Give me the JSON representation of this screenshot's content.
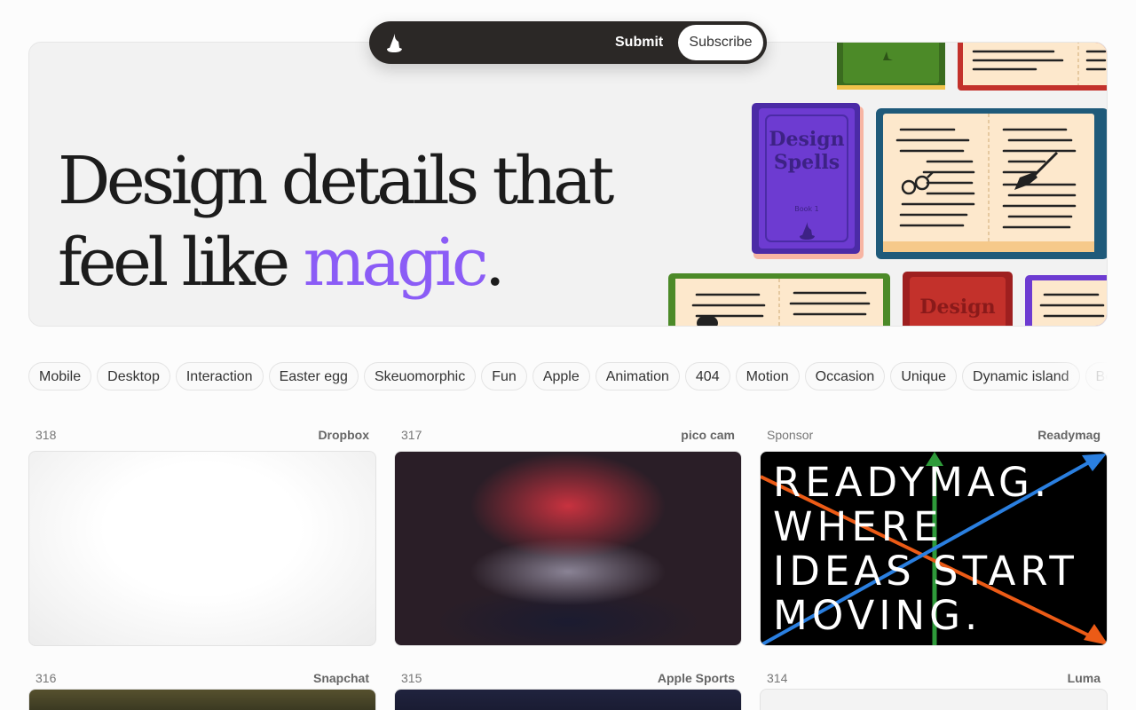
{
  "nav": {
    "logo_icon": "wizard-hat-icon",
    "submit_label": "Submit",
    "subscribe_label": "Subscribe"
  },
  "hero": {
    "line1": "Design details that",
    "line2_prefix": "feel like ",
    "line2_accent": "magic",
    "line2_suffix": ".",
    "accent_color": "#8b5cf6",
    "book_text": {
      "title_line1": "Design",
      "title_line2": "Spells",
      "subtitle": "Book 1"
    }
  },
  "tags": [
    "Mobile",
    "Desktop",
    "Interaction",
    "Easter egg",
    "Skeuomorphic",
    "Fun",
    "Apple",
    "Animation",
    "404",
    "Motion",
    "Occasion",
    "Unique",
    "Dynamic island",
    "Be"
  ],
  "cards": [
    {
      "number": "318",
      "brand": "Dropbox"
    },
    {
      "number": "317",
      "brand": "pico cam"
    },
    {
      "number": "Sponsor",
      "brand": "Readymag",
      "text": "READYMAG.\nWHERE\nIDEAS START\nMOVING."
    },
    {
      "number": "316",
      "brand": "Snapchat"
    },
    {
      "number": "315",
      "brand": "Apple Sports"
    },
    {
      "number": "314",
      "brand": "Luma"
    }
  ]
}
